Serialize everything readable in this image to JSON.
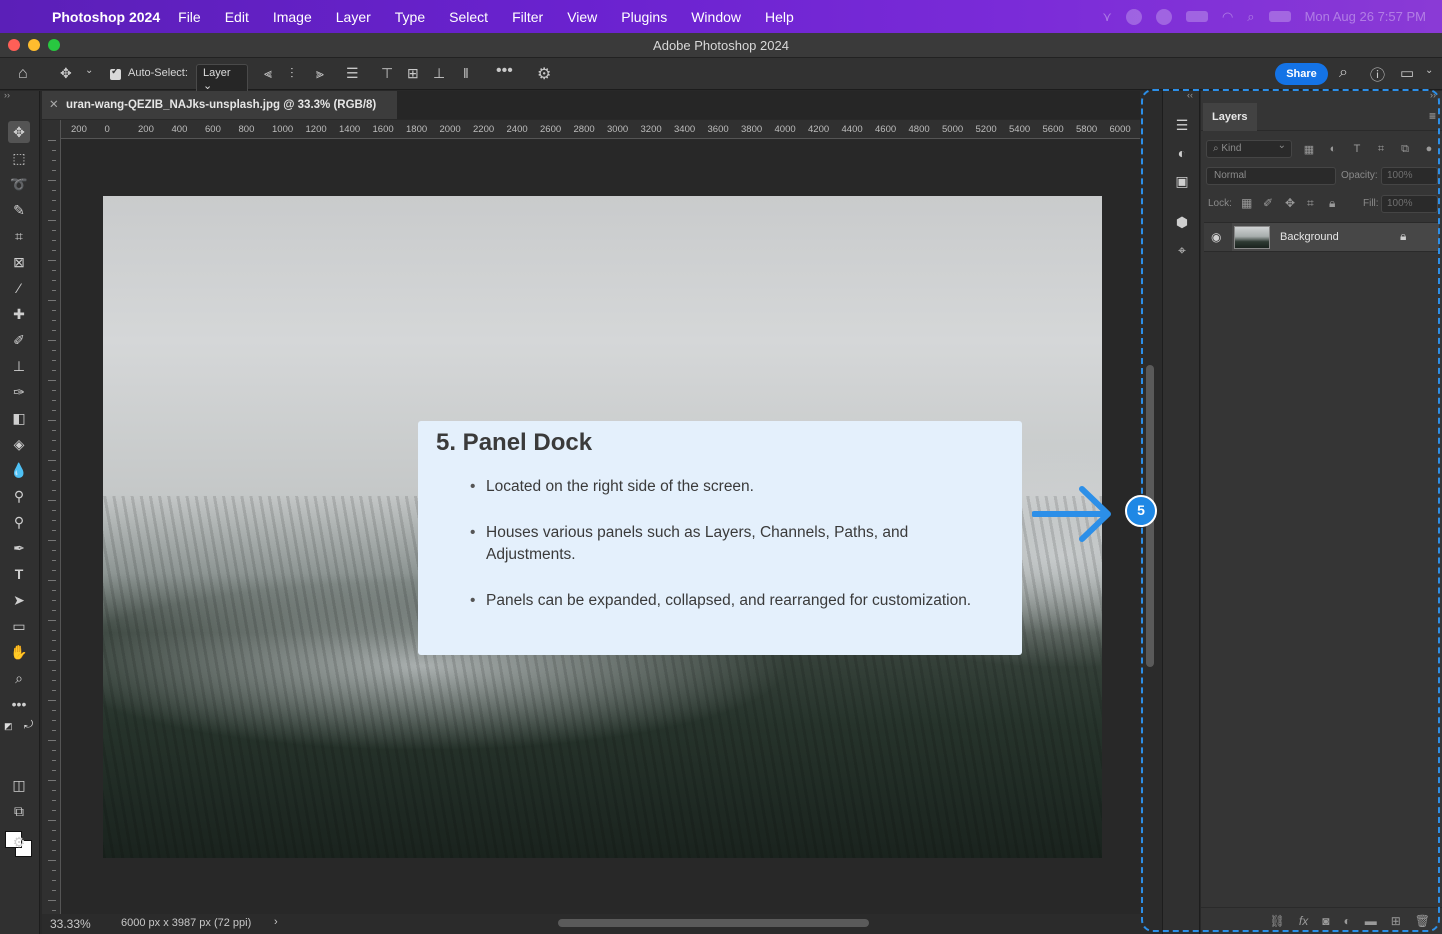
{
  "menubar": {
    "app_name": "Photoshop 2024",
    "items": [
      "File",
      "Edit",
      "Image",
      "Layer",
      "Type",
      "Select",
      "Filter",
      "View",
      "Plugins",
      "Window",
      "Help"
    ],
    "clock": "Mon Aug 26  7:57 PM"
  },
  "window": {
    "title": "Adobe Photoshop 2024"
  },
  "options": {
    "auto_select_label": "Auto-Select:",
    "auto_select_value": "Layer",
    "share_label": "Share"
  },
  "document": {
    "tab_title": "uran-wang-QEZIB_NAJks-unsplash.jpg @ 33.3% (RGB/8)"
  },
  "ruler": {
    "labels": [
      "200",
      "0",
      "200",
      "400",
      "600",
      "800",
      "1000",
      "1200",
      "1400",
      "1600",
      "1800",
      "2000",
      "2200",
      "2400",
      "2600",
      "2800",
      "3000",
      "3200",
      "3400",
      "3600",
      "3800",
      "4000",
      "4200",
      "4400",
      "4600",
      "4800",
      "5000",
      "5200",
      "5400",
      "5600",
      "5800",
      "6000"
    ]
  },
  "status": {
    "zoom": "33.33%",
    "info": "6000 px x 3987 px (72 ppi)"
  },
  "layers_panel": {
    "tab": "Layers",
    "filter_kind": "Kind",
    "blend_mode": "Normal",
    "opacity_label": "Opacity:",
    "opacity_value": "100%",
    "lock_label": "Lock:",
    "fill_label": "Fill:",
    "fill_value": "100%",
    "layers": [
      {
        "name": "Background",
        "visible": true,
        "locked": true
      }
    ]
  },
  "callout": {
    "title": "5. Panel Dock",
    "points": [
      "Located on the right side of the screen.",
      "Houses various panels such as Layers, Channels, Paths, and Adjustments.",
      "Panels can be expanded, collapsed, and rearranged for customization."
    ],
    "badge": "5",
    "accent": "#1f88e5"
  }
}
